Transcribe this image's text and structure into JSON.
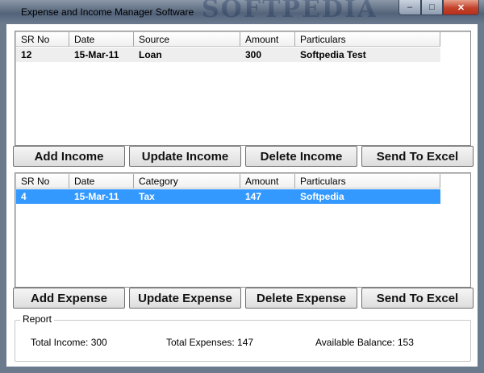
{
  "window": {
    "title": "Expense and Income Manager Software",
    "watermark": "SOFTPEDIA",
    "minimize_glyph": "–",
    "maximize_glyph": "□",
    "close_glyph": "✕"
  },
  "columns_income": [
    "SR No",
    "Date",
    "Source",
    "Amount",
    "Particulars"
  ],
  "income_rows": [
    {
      "sr": "12",
      "date": "15-Mar-11",
      "source": "Loan",
      "amount": "300",
      "particulars": "Softpedia Test"
    }
  ],
  "income_buttons": {
    "add": "Add Income",
    "update": "Update Income",
    "delete": "Delete Income",
    "excel": "Send To Excel"
  },
  "columns_expense": [
    "SR No",
    "Date",
    "Category",
    "Amount",
    "Particulars"
  ],
  "expense_rows": [
    {
      "sr": "4",
      "date": "15-Mar-11",
      "category": "Tax",
      "amount": "147",
      "particulars": "Softpedia"
    }
  ],
  "expense_buttons": {
    "add": "Add Expense",
    "update": "Update Expense",
    "delete": "Delete Expense",
    "excel": "Send To Excel"
  },
  "report": {
    "legend": "Report",
    "total_income": "Total Income: 300",
    "total_expenses": "Total Expenses: 147",
    "available_balance": "Available Balance: 153"
  },
  "colors": {
    "selected_row": "#3399ff",
    "title_bar": "#5f6e82",
    "close_button": "#c2412a"
  }
}
